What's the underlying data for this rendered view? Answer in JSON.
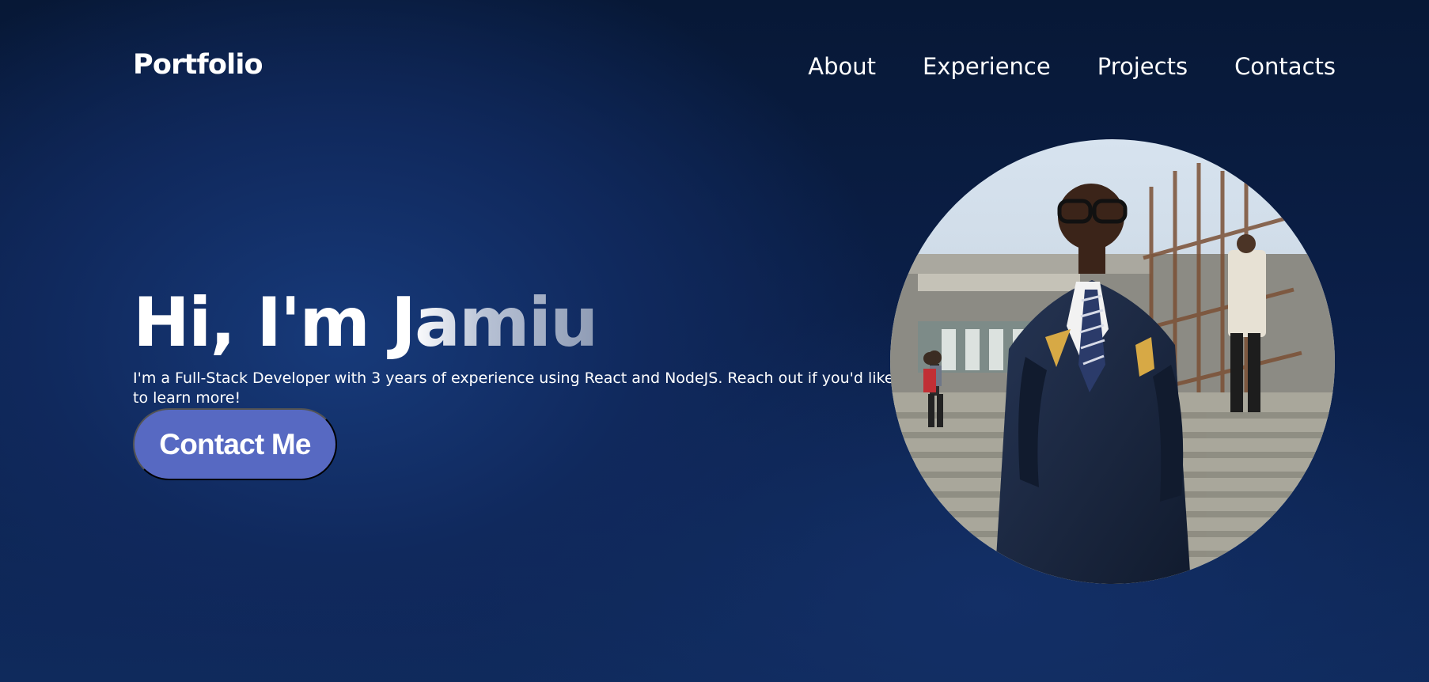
{
  "header": {
    "brand": "Portfolio",
    "nav": [
      {
        "label": "About"
      },
      {
        "label": "Experience"
      },
      {
        "label": "Projects"
      },
      {
        "label": "Contacts"
      }
    ]
  },
  "hero": {
    "title": "Hi, I'm Jamiu",
    "description": "I'm a Full-Stack Developer with 3 years of experience using React and NodeJS. Reach out if you'd like to learn more!",
    "cta_label": "Contact Me"
  },
  "colors": {
    "background": "#0b1f48",
    "button": "#5769c2",
    "text": "#ffffff"
  }
}
